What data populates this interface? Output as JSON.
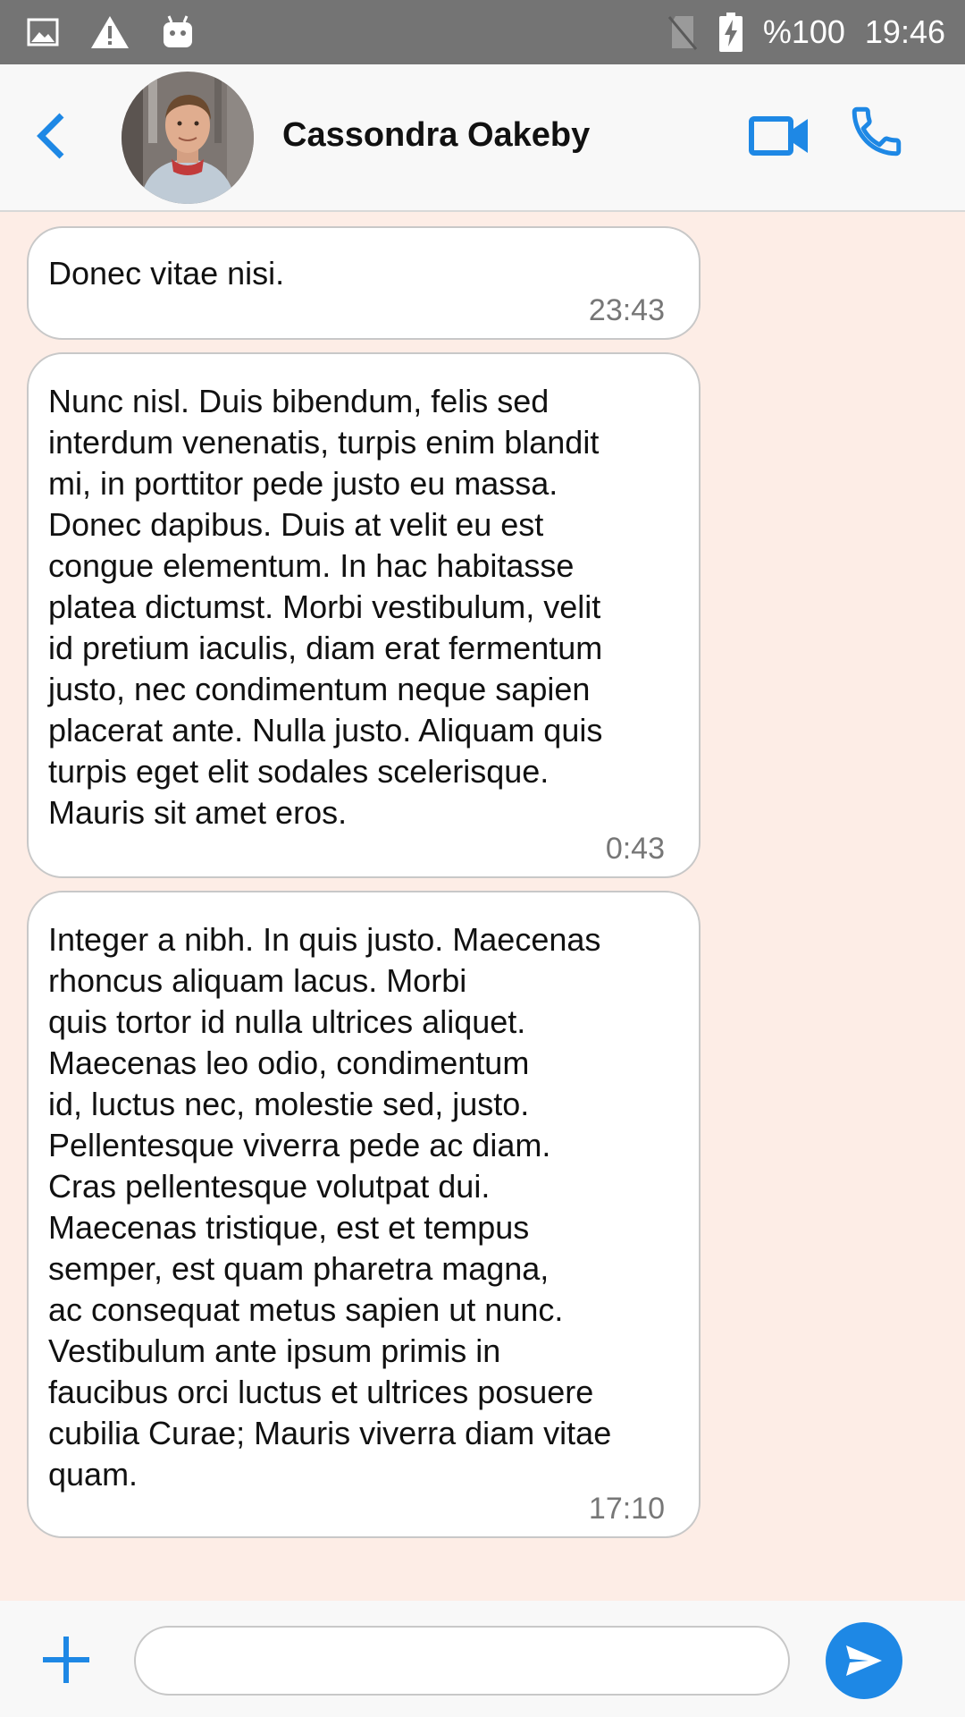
{
  "status_bar": {
    "battery_text": "%100",
    "time": "19:46",
    "icons": [
      "image-icon",
      "warning-icon",
      "android-icon",
      "no-sim-icon",
      "battery-charging-icon"
    ]
  },
  "header": {
    "contact_name": "Cassondra Oakeby",
    "icons": [
      "back-chevron-icon",
      "video-call-icon",
      "phone-icon"
    ]
  },
  "messages": [
    {
      "text": "Donec vitae nisi.",
      "time": "23:43"
    },
    {
      "text": "Nunc nisl. Duis bibendum, felis sed\ninterdum venenatis, turpis enim blandit\nmi, in porttitor pede justo eu massa.\nDonec dapibus. Duis at velit eu est\ncongue elementum. In hac habitasse\nplatea dictumst. Morbi vestibulum, velit\nid pretium iaculis, diam erat fermentum\njusto, nec condimentum neque sapien\nplacerat ante. Nulla justo. Aliquam quis\nturpis eget elit sodales scelerisque.\nMauris sit amet eros.",
      "time": "0:43"
    },
    {
      "text": "Integer a nibh. In quis justo. Maecenas\nrhoncus aliquam lacus. Morbi\nquis tortor id nulla ultrices aliquet.\nMaecenas leo odio, condimentum\nid, luctus nec, molestie sed, justo.\nPellentesque viverra pede ac diam.\nCras pellentesque volutpat dui.\nMaecenas tristique, est et tempus\nsemper, est quam pharetra magna,\nac consequat metus sapien ut nunc.\nVestibulum ante ipsum primis in\nfaucibus orci luctus et ultrices posuere\ncubilia Curae; Mauris viverra diam vitae\nquam.",
      "time": "17:10"
    }
  ],
  "composer": {
    "input_value": "",
    "input_placeholder": ""
  },
  "colors": {
    "accent": "#1e88e5",
    "chat_background": "#fdede6",
    "status_bar": "#747474"
  }
}
